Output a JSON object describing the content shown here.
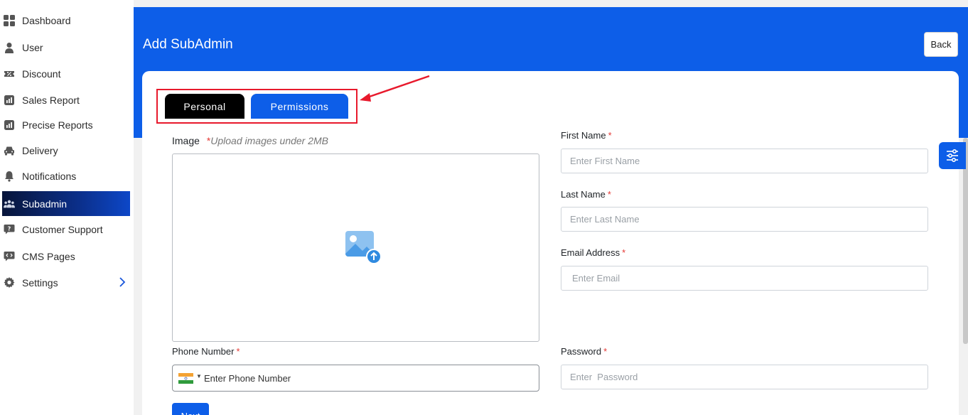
{
  "sidebar": {
    "items": [
      {
        "label": "Dashboard",
        "icon": "grid-icon"
      },
      {
        "label": "User",
        "icon": "user-icon"
      },
      {
        "label": "Discount",
        "icon": "discount-ticket-icon"
      },
      {
        "label": "Sales Report",
        "icon": "bar-report-icon"
      },
      {
        "label": "Precise Reports",
        "icon": "bar-report-icon"
      },
      {
        "label": "Delivery",
        "icon": "car-icon"
      },
      {
        "label": "Notifications",
        "icon": "bell-icon"
      },
      {
        "label": "Subadmin",
        "icon": "group-icon",
        "active": true
      },
      {
        "label": "Customer Support",
        "icon": "chat-question-icon"
      },
      {
        "label": "CMS Pages",
        "icon": "chat-code-icon"
      },
      {
        "label": "Settings",
        "icon": "gear-icon",
        "has_submenu": true
      }
    ]
  },
  "header": {
    "title": "Add SubAdmin",
    "back_label": "Back"
  },
  "tabs": [
    {
      "label": "Personal",
      "active": true
    },
    {
      "label": "Permissions",
      "active": false
    }
  ],
  "form": {
    "image": {
      "label": "Image",
      "required_mark": "*",
      "hint": "Upload images under 2MB"
    },
    "first_name": {
      "label": "First Name",
      "required_mark": "*",
      "placeholder": "Enter First Name",
      "value": ""
    },
    "last_name": {
      "label": "Last Name",
      "required_mark": "*",
      "placeholder": "Enter Last Name",
      "value": ""
    },
    "email": {
      "label": "Email Address",
      "required_mark": "*",
      "placeholder": "Enter Email",
      "value": ""
    },
    "phone": {
      "label": "Phone Number",
      "required_mark": "*",
      "placeholder": "Enter Phone Number",
      "country": "India",
      "value": ""
    },
    "password": {
      "label": "Password",
      "required_mark": "*",
      "placeholder": "Enter  Password",
      "value": ""
    },
    "next_label": "Next"
  },
  "colors": {
    "primary": "#0d5ee8",
    "tab_active": "#000000",
    "highlight": "#e8192c",
    "required": "#e53935"
  }
}
